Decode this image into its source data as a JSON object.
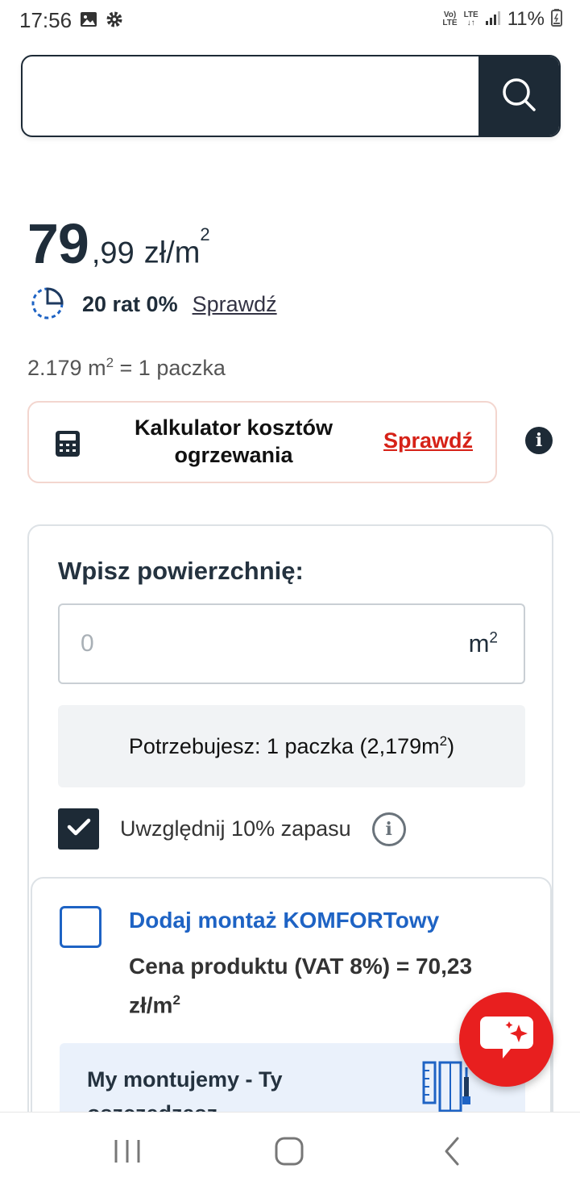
{
  "status_bar": {
    "time": "17:56",
    "network_volte": "Vo)",
    "network_lte1": "LTE",
    "network_lte2": "LTE",
    "battery": "11%"
  },
  "search": {
    "placeholder": "",
    "button_icon": "search-icon"
  },
  "price": {
    "integer": "79",
    "decimal": ",99",
    "unit": "zł/m",
    "unit_sup": "2"
  },
  "installments": {
    "text": "20 rat 0%",
    "link": "Sprawdź"
  },
  "package_info": {
    "area": "2.179 m",
    "sup": "2",
    "rest": " = 1 paczka"
  },
  "calculator_card": {
    "title": "Kalkulator kosztów ogrzewania",
    "link": "Sprawdź",
    "link_color": "#d62218"
  },
  "area_calculator": {
    "label": "Wpisz powierzchnię:",
    "input_placeholder": "0",
    "unit": "m",
    "unit_sup": "2",
    "need_text": "Potrzebujesz: 1 paczka (2,179m",
    "need_sup": "2",
    "need_end": ")",
    "reserve_label": "Uwzględnij 10% zapasu",
    "reserve_checked": true
  },
  "mounting": {
    "title": "Dodaj montaż KOMFORTowy",
    "price_text": "Cena produktu (VAT 8%) = 70,23 zł/m",
    "price_sup": "2",
    "promo_text": "My montujemy - Ty oszczędzasz",
    "checked": false,
    "accent_color": "#1e63c4"
  },
  "chat": {
    "icon": "chat-sparkle-icon",
    "color": "#e81f1f"
  },
  "nav": {
    "recents": "recents-icon",
    "home": "home-icon",
    "back": "back-icon"
  }
}
